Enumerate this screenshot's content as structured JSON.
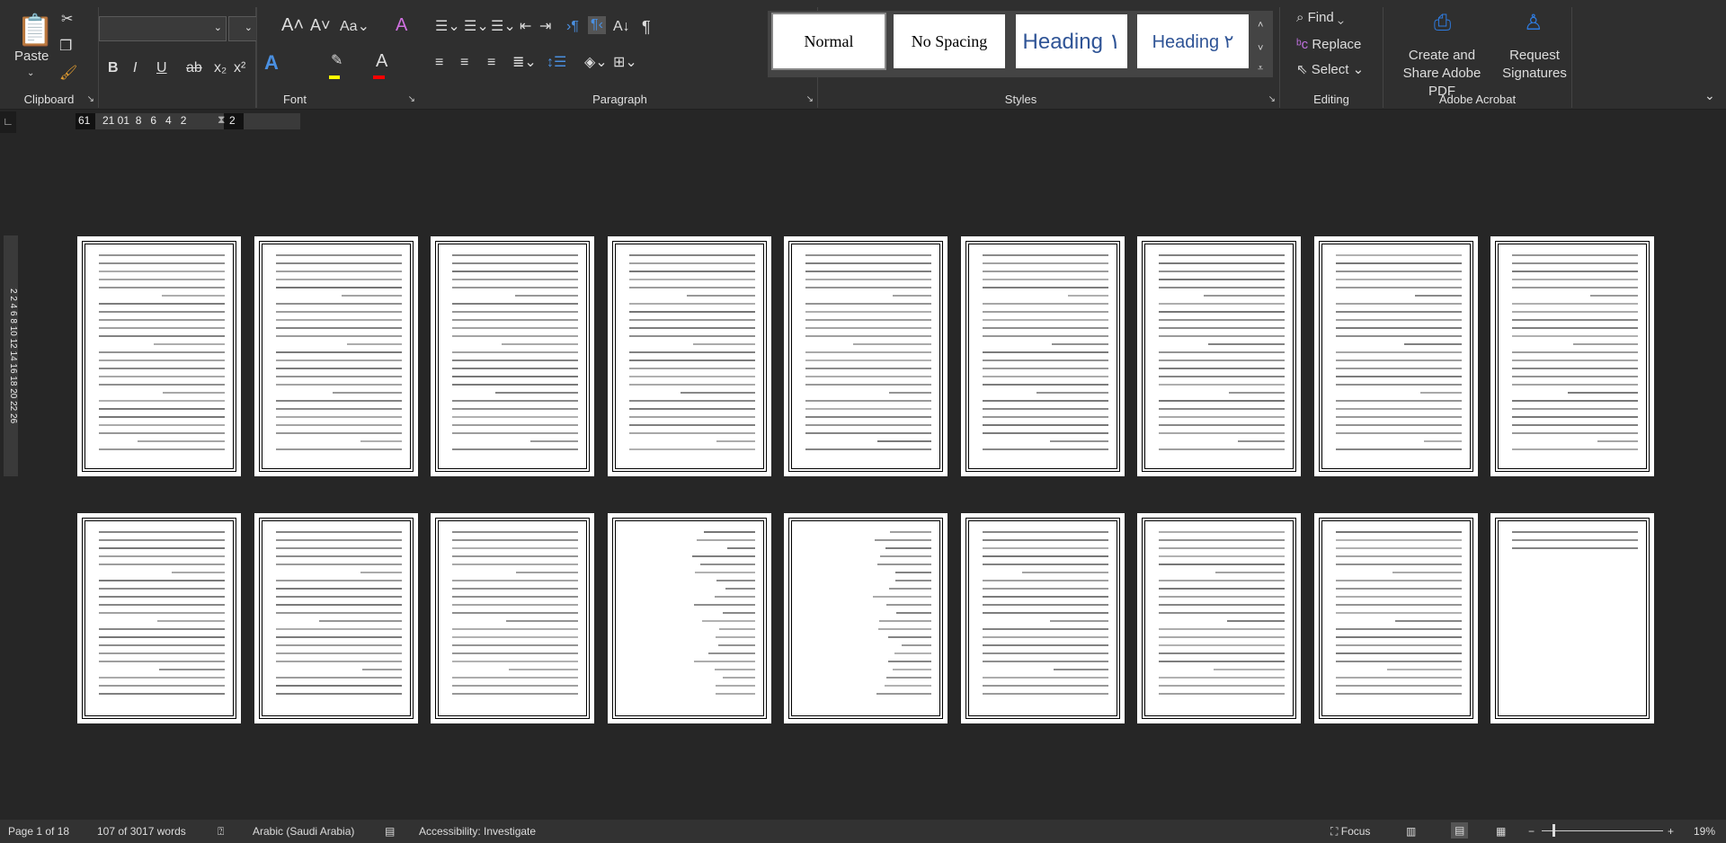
{
  "ribbon": {
    "clipboard": {
      "label": "Clipboard",
      "paste": "Paste"
    },
    "font": {
      "label": "Font",
      "font_name": "",
      "font_size": ""
    },
    "paragraph": {
      "label": "Paragraph"
    },
    "styles": {
      "label": "Styles",
      "items": [
        "Normal",
        "No Spacing",
        "Heading ١",
        "Heading ٢"
      ]
    },
    "editing": {
      "label": "Editing",
      "find": "Find",
      "replace": "Replace",
      "select": "Select"
    },
    "acrobat": {
      "label": "Adobe Acrobat",
      "create": "Create and Share Adobe PDF",
      "request": "Request Signatures"
    }
  },
  "ruler": {
    "left": "61",
    "ticks": "21 01  8   6   4   2",
    "right": "2"
  },
  "vruler": "2  2  4  6  8 10 12 14 16 18 20 22  26",
  "document": {
    "page_count": 18,
    "rows": 2,
    "per_row": 9
  },
  "status": {
    "page": "Page 1 of 18",
    "words": "107 of 3017 words",
    "language": "Arabic (Saudi Arabia)",
    "accessibility": "Accessibility: Investigate",
    "focus": "Focus",
    "zoom": "19%"
  },
  "colors": {
    "highlight": "#ffff00",
    "font_color": "#ff0000",
    "accent": "#4a8fe0"
  }
}
